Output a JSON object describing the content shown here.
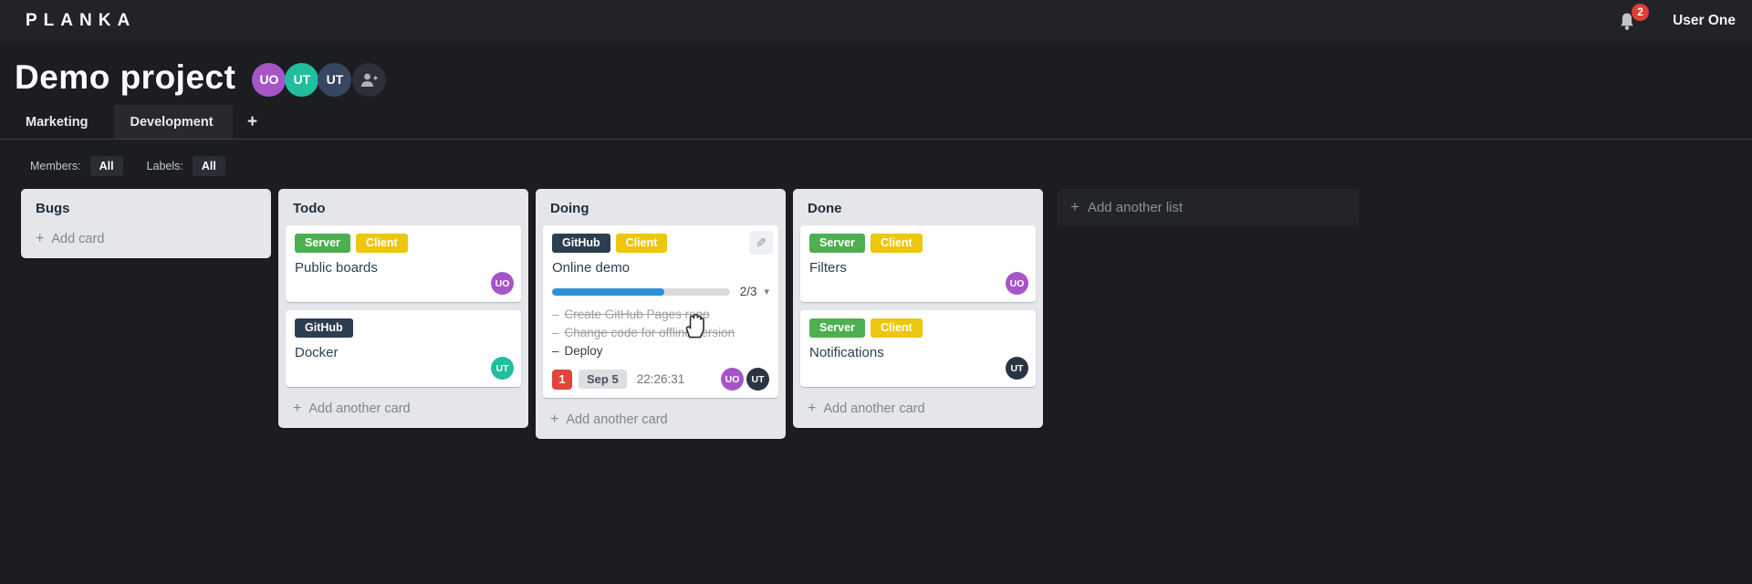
{
  "app": {
    "logo": "PLANKA",
    "user_name": "User One",
    "notification_count": "2",
    "notification_badge_color": "#e13d34"
  },
  "project": {
    "title": "Demo project",
    "members": [
      {
        "initials": "UO",
        "color": "#a555c8"
      },
      {
        "initials": "UT",
        "color": "#21bd9c"
      },
      {
        "initials": "UT",
        "color": "#384760"
      }
    ]
  },
  "tabs": {
    "items": [
      {
        "label": "Marketing"
      },
      {
        "label": "Development"
      }
    ],
    "add_label": "+"
  },
  "filters": {
    "members_label": "Members:",
    "members_value": "All",
    "labels_label": "Labels:",
    "labels_value": "All"
  },
  "task_bullet": "–",
  "board": {
    "add_list_plus": "+",
    "add_list_label": "Add another list",
    "lists": [
      {
        "title": "Bugs",
        "add_plus": "+",
        "add_label": "Add card",
        "cards": []
      },
      {
        "title": "Todo",
        "add_plus": "+",
        "add_label": "Add another card",
        "cards": [
          {
            "title": "Public boards",
            "labels": [
              {
                "text": "Server",
                "color": "#4daf4f"
              },
              {
                "text": "Client",
                "color": "#edc60e"
              }
            ],
            "members": [
              {
                "initials": "UO",
                "color": "#a555c8"
              }
            ]
          },
          {
            "title": "Docker",
            "labels": [
              {
                "text": "GitHub",
                "color": "#2d3e50"
              }
            ],
            "members": [
              {
                "initials": "UT",
                "color": "#21bd9c"
              }
            ]
          }
        ]
      },
      {
        "title": "Doing",
        "add_plus": "+",
        "add_label": "Add another card",
        "cards": [
          {
            "title": "Online demo",
            "labels": [
              {
                "text": "GitHub",
                "color": "#2d3e50"
              },
              {
                "text": "Client",
                "color": "#edc60e"
              }
            ],
            "edit_icon": "✎",
            "progress": {
              "completed": 2,
              "total": 3,
              "display": "2/3",
              "percent_css": "63%",
              "fill_color": "#2e8fd8",
              "caret": "▾"
            },
            "tasks": [
              {
                "text": "Create GitHub Pages repo",
                "done": true
              },
              {
                "text": "Change code for offline version",
                "done": true
              },
              {
                "text": "Deploy",
                "done": false
              }
            ],
            "notification_count": "1",
            "notification_color": "#e0443a",
            "due_date": "Sep 5",
            "timer": "22:26:31",
            "members": [
              {
                "initials": "UO",
                "color": "#a555c8"
              },
              {
                "initials": "UT",
                "color": "#2b3442"
              }
            ]
          }
        ]
      },
      {
        "title": "Done",
        "add_plus": "+",
        "add_label": "Add another card",
        "cards": [
          {
            "title": "Filters",
            "labels": [
              {
                "text": "Server",
                "color": "#4daf4f"
              },
              {
                "text": "Client",
                "color": "#edc60e"
              }
            ],
            "members": [
              {
                "initials": "UO",
                "color": "#a555c8"
              }
            ]
          },
          {
            "title": "Notifications",
            "labels": [
              {
                "text": "Server",
                "color": "#4daf4f"
              },
              {
                "text": "Client",
                "color": "#edc60e"
              }
            ],
            "members": [
              {
                "initials": "UT",
                "color": "#2b3442"
              }
            ]
          }
        ]
      }
    ]
  }
}
